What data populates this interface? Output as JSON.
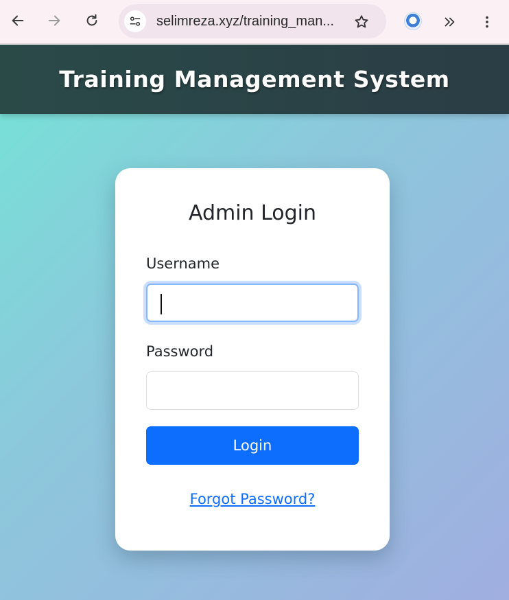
{
  "browser": {
    "url": "selimreza.xyz/training_man...",
    "icons": {
      "back": "arrow-left-icon",
      "forward": "arrow-right-icon",
      "reload": "reload-icon",
      "site_info": "tune-icon",
      "bookmark": "star-icon",
      "extension": "extension-icon",
      "more_extensions": "double-chevron-right-icon",
      "menu": "kebab-menu-icon"
    }
  },
  "header": {
    "title": "Training Management System"
  },
  "login": {
    "heading": "Admin Login",
    "username_label": "Username",
    "username_value": "",
    "password_label": "Password",
    "password_value": "",
    "submit_label": "Login",
    "forgot_label": "Forgot Password?"
  },
  "colors": {
    "header_bg": "#2b4147",
    "primary_button": "#0d6efd",
    "link": "#0d6efd",
    "focus_ring": "#86b7fe",
    "gradient_start": "#74e4d6",
    "gradient_end": "#a0aee0"
  }
}
